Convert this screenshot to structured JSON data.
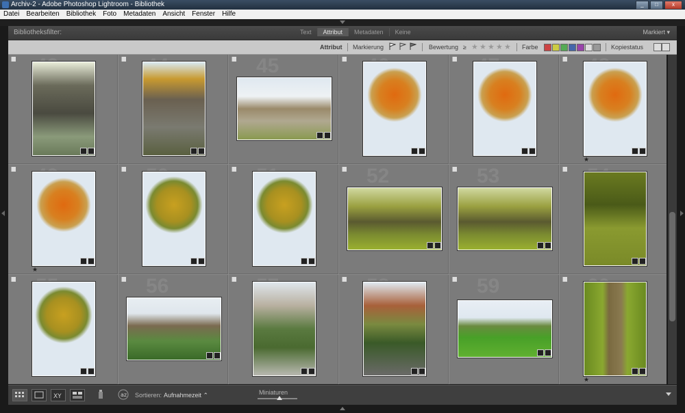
{
  "window": {
    "title": "Archiv-2 - Adobe Photoshop Lightroom - Bibliothek"
  },
  "menu": [
    "Datei",
    "Bearbeiten",
    "Bibliothek",
    "Foto",
    "Metadaten",
    "Ansicht",
    "Fenster",
    "Hilfe"
  ],
  "filterbar": {
    "label": "Bibliotheksfilter:",
    "tabs": [
      "Text",
      "Attribut",
      "Metadaten",
      "Keine"
    ],
    "active_tab": "Attribut",
    "preset": "Markiert ▾"
  },
  "attributebar": {
    "attribut": "Attribut",
    "markierung": "Markierung",
    "bewertung": "Bewertung",
    "bewertung_op": "≥",
    "farbe": "Farbe",
    "kopiestatus": "Kopiestatus",
    "label_colors": [
      "#c44",
      "#cc4",
      "#5a5",
      "#46a",
      "#94a",
      "#ddd",
      "#999"
    ]
  },
  "thumbnails": [
    {
      "num": "43",
      "scene": "tunnel",
      "star": false
    },
    {
      "num": "44",
      "scene": "alley",
      "star": false
    },
    {
      "num": "45",
      "scene": "wall-landscape",
      "star": false
    },
    {
      "num": "46",
      "scene": "tree-orange",
      "star": false
    },
    {
      "num": "47",
      "scene": "tree-orange",
      "star": false
    },
    {
      "num": "48",
      "scene": "tree-orange",
      "star": true
    },
    {
      "num": "49",
      "scene": "tree-orange",
      "star": true
    },
    {
      "num": "50",
      "scene": "tree-yellow",
      "star": false
    },
    {
      "num": "51",
      "scene": "tree-yellow",
      "star": false
    },
    {
      "num": "52",
      "scene": "pavilion-landscape",
      "star": false
    },
    {
      "num": "53",
      "scene": "pavilion-landscape",
      "star": false
    },
    {
      "num": "54",
      "scene": "tree-green",
      "star": false
    },
    {
      "num": "55",
      "scene": "tree-yellow",
      "star": false
    },
    {
      "num": "56",
      "scene": "village-landscape",
      "star": false
    },
    {
      "num": "57",
      "scene": "church",
      "star": false
    },
    {
      "num": "58",
      "scene": "castle",
      "star": false
    },
    {
      "num": "59",
      "scene": "lawn-landscape",
      "star": false
    },
    {
      "num": "60",
      "scene": "post",
      "star": true
    }
  ],
  "toolbar": {
    "sort_label": "Sortieren:",
    "sort_value": "Aufnahmezeit ⌃",
    "thumbs_label": "Miniaturen"
  }
}
